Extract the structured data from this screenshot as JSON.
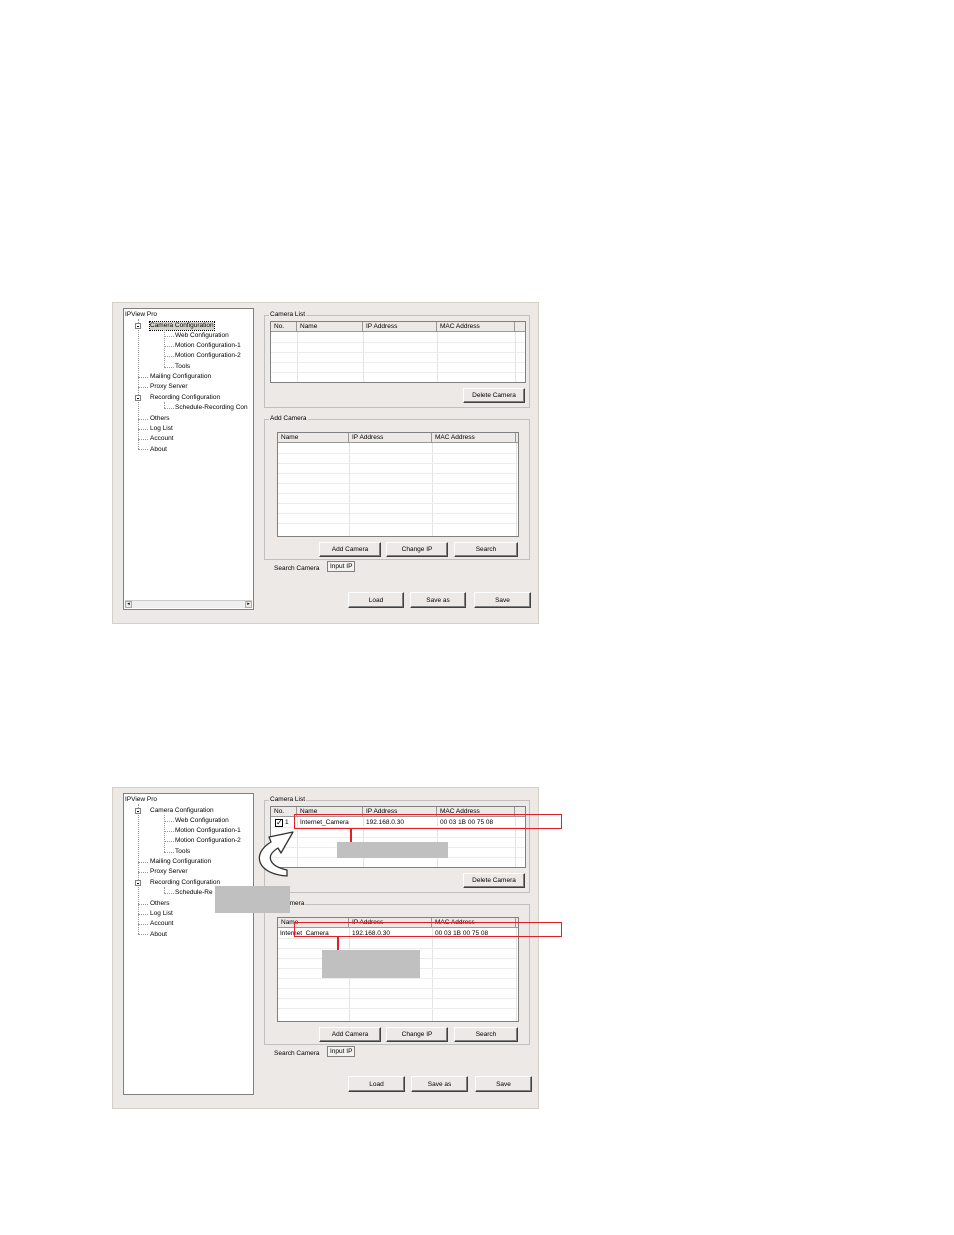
{
  "tree": {
    "root": "IPView Pro",
    "items": [
      "Camera Configuration",
      "Web Configuration",
      "Motion Configuration-1",
      "Motion Configuration-2",
      "Tools",
      "Mailing Configuration",
      "Proxy Server",
      "Recording Configuration",
      "Schedule-Recording Con",
      "Others",
      "Log List",
      "Account",
      "About"
    ],
    "items2_truncated_schedule": "Schedule-Re"
  },
  "camera_list": {
    "title": "Camera List",
    "columns": [
      "No.",
      "Name",
      "IP Address",
      "MAC Address"
    ],
    "delete_button": "Delete Camera",
    "row": {
      "no": "1",
      "name": "Internet_Camera",
      "ip": "192.168.0.30",
      "mac": "00 03 1B 00 75 08"
    }
  },
  "add_camera": {
    "title": "Add Camera",
    "title_partial": "amera",
    "columns": [
      "Name",
      "IP Address",
      "MAC Address"
    ],
    "buttons": [
      "Add Camera",
      "Change IP",
      "Search"
    ],
    "tabs": [
      "Search Camera",
      "Input IP"
    ],
    "row": {
      "name": "Internet_Camera",
      "ip": "192.168.0.30",
      "mac": "00 03 1B 00 75 08"
    }
  },
  "footer_buttons": [
    "Load",
    "Save as",
    "Save"
  ],
  "colors": {
    "annotation_red": "#e21e26",
    "panel": "#ece9e6",
    "callout_grey": "#c0c0c0"
  }
}
